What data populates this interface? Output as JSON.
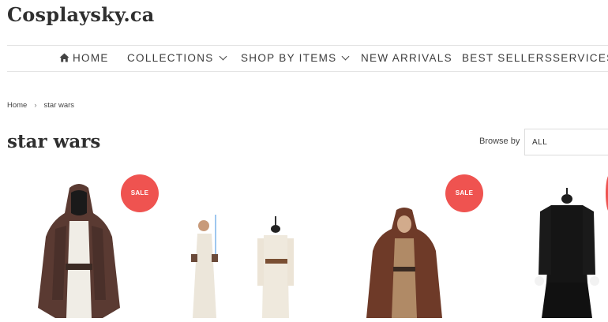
{
  "site": {
    "logo": "Cosplaysky.ca"
  },
  "nav": {
    "items": [
      {
        "label": "HOME",
        "icon": "home-icon"
      },
      {
        "label": "COLLECTIONS",
        "icon": "chevron-down-icon"
      },
      {
        "label": "SHOP BY ITEMS",
        "icon": "chevron-down-icon"
      },
      {
        "label": "NEW ARRIVALS"
      },
      {
        "label": "BEST SELLERS"
      },
      {
        "label": "SERVICES"
      }
    ]
  },
  "breadcrumb": {
    "home": "Home",
    "separator": "›",
    "current": "star wars"
  },
  "page": {
    "title": "star wars"
  },
  "browse": {
    "label": "Browse by",
    "value": "ALL"
  },
  "products": [
    {
      "badge": "SALE",
      "image": "brown-jedi-robe-costume"
    },
    {
      "badge": "",
      "image": "white-desert-outfit-costume"
    },
    {
      "badge": "SALE",
      "image": "brown-hooded-jedi-costume"
    },
    {
      "badge": "",
      "image": "black-imperial-uniform-costume"
    }
  ],
  "colors": {
    "sale": "#ef5350",
    "text": "#2f2f2f",
    "border": "#e3e3e3"
  }
}
